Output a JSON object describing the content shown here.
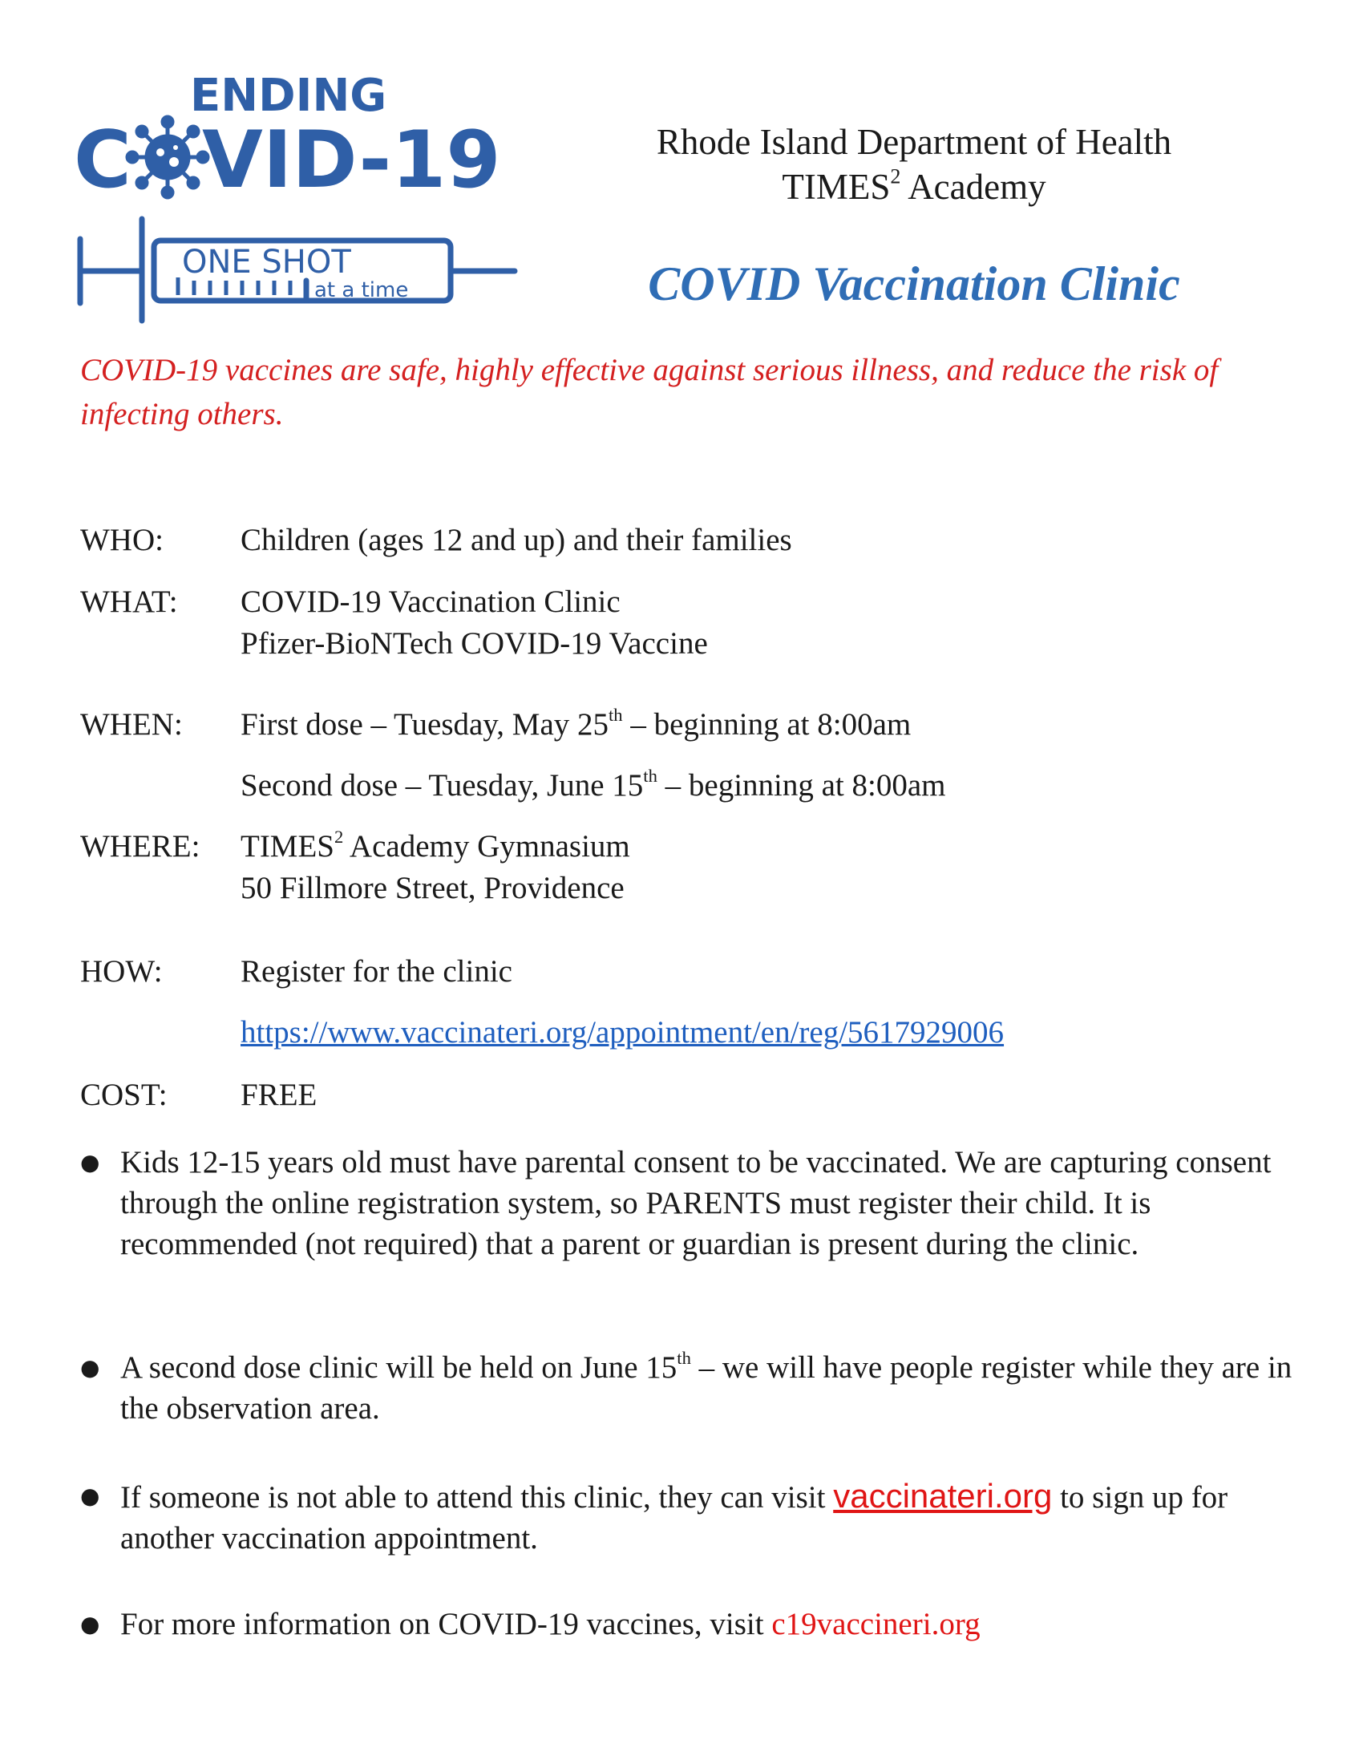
{
  "logo": {
    "line1": "ENDING",
    "line2_left": "C",
    "line2_right": "VID-19",
    "syringe_text1": "ONE SHOT",
    "syringe_text2": "at a time",
    "color": "#2f5fa7"
  },
  "header": {
    "org": "Rhode Island Department of Health",
    "school_pre": "TIMES",
    "school_sup": "2",
    "school_post": " Academy",
    "clinic_title": "COVID Vaccination Clinic"
  },
  "tagline": "COVID-19 vaccines are safe, highly effective against serious illness, and reduce the risk of infecting others.",
  "details": {
    "who": {
      "label": "WHO:",
      "value": "Children (ages 12 and up) and their families"
    },
    "what": {
      "label": "WHAT:",
      "line1": "COVID-19 Vaccination Clinic",
      "line2": "Pfizer-BioNTech COVID-19 Vaccine"
    },
    "when": {
      "label": "WHEN:",
      "dose1_pre": "First dose – Tuesday, May 25",
      "dose1_sup": "th",
      "dose1_post": " – beginning at 8:00am",
      "dose2_pre": "Second dose – Tuesday, June 15",
      "dose2_sup": "th",
      "dose2_post": " – beginning at 8:00am"
    },
    "where": {
      "label": "WHERE:",
      "line1_pre": "TIMES",
      "line1_sup": "2",
      "line1_post": " Academy Gymnasium",
      "line2": "50 Fillmore Street, Providence"
    },
    "how": {
      "label": "HOW:",
      "line1": "Register for the clinic",
      "link": "https://www.vaccinateri.org/appointment/en/reg/5617929006"
    },
    "cost": {
      "label": "COST:",
      "value": "FREE"
    }
  },
  "bullets": {
    "b1": "Kids 12-15 years old must have parental consent to be vaccinated. We are capturing consent through the online registration system, so PARENTS must register their child. It is recommended (not required) that a parent or guardian is present during the clinic.",
    "b2_pre": "A second dose clinic will be held on June 15",
    "b2_sup": "th",
    "b2_post": " – we will have people register while they are in the observation area.",
    "b3_pre": "If someone is not able to attend this clinic, they can visit ",
    "b3_link": "vaccinateri.org",
    "b3_post": " to sign up for another vaccination appointment.",
    "b4_pre": "For more information on COVID-19 vaccines, visit ",
    "b4_link": "c19vaccineri.org"
  },
  "colors": {
    "title_blue": "#2f6db5",
    "tagline_red": "#d42020",
    "link_blue": "#1f5fbf",
    "link_red": "#e01515"
  }
}
